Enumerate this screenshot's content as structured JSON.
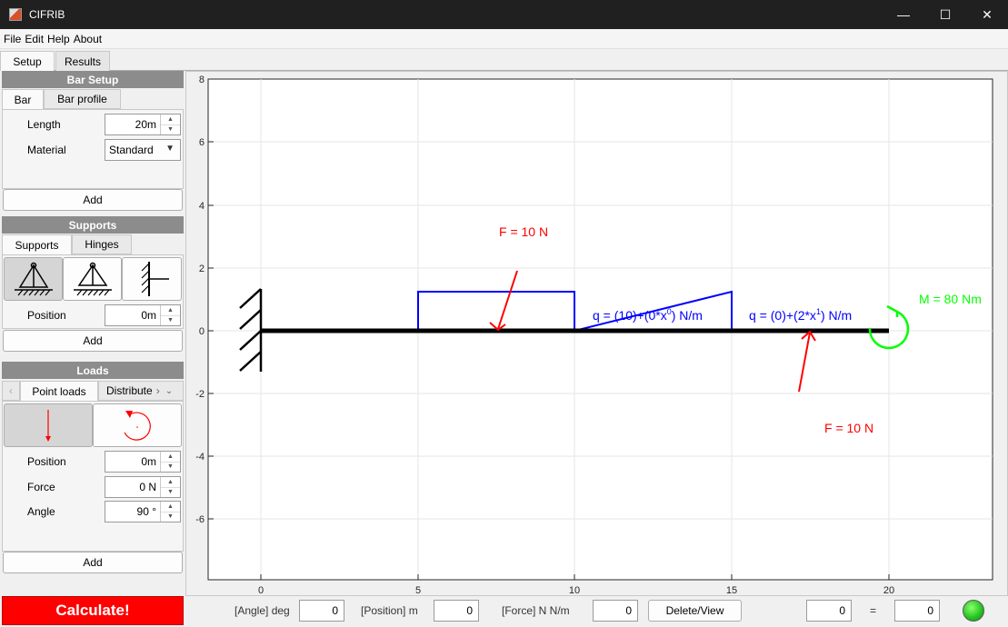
{
  "window": {
    "title": "CIFRIB"
  },
  "menu": [
    "File",
    "Edit",
    "Help",
    "About"
  ],
  "main_tabs": [
    "Setup",
    "Results"
  ],
  "bar_setup": {
    "title": "Bar Setup",
    "tabs": [
      "Bar",
      "Bar profile"
    ],
    "length_label": "Length",
    "length_value": "20m",
    "material_label": "Material",
    "material_value": "Standard",
    "add_label": "Add"
  },
  "supports": {
    "title": "Supports",
    "tabs": [
      "Supports",
      "Hinges"
    ],
    "position_label": "Position",
    "position_value": "0m",
    "add_label": "Add"
  },
  "loads": {
    "title": "Loads",
    "tabs": [
      "Point loads",
      "Distribute"
    ],
    "position_label": "Position",
    "position_value": "0m",
    "force_label": "Force",
    "force_value": "0 N",
    "angle_label": "Angle",
    "angle_value": "90 °",
    "add_label": "Add"
  },
  "calculate_label": "Calculate!",
  "plot": {
    "x_ticks": [
      "0",
      "5",
      "10",
      "15",
      "20"
    ],
    "y_ticks": [
      "8",
      "6",
      "4",
      "2",
      "0",
      "-2",
      "-4",
      "-6"
    ],
    "force_label_top": "F = 10 N",
    "force_label_bottom": "F = 10 N",
    "moment_label": "M = 80 Nm",
    "dist_label_1": "q  =  (10)+(0*x",
    "dist_label_1_sup": "0",
    "dist_label_1_tail": ")  N/m",
    "dist_label_2": "q  =  (0)+(2*x",
    "dist_label_2_sup": "1",
    "dist_label_2_tail": ")  N/m",
    "colors": {
      "force": "#ff0000",
      "distributed": "#0000ff",
      "moment": "#00ff00",
      "bar": "#000000"
    }
  },
  "bottom": {
    "angle_label": "[Angle] deg",
    "angle_value": "0",
    "position_label": "[Position] m",
    "position_value": "0",
    "force_label": "[Force] N N/m",
    "force_value": "0",
    "delete_label": "Delete/View",
    "left_value": "0",
    "equals": "=",
    "right_value": "0"
  }
}
